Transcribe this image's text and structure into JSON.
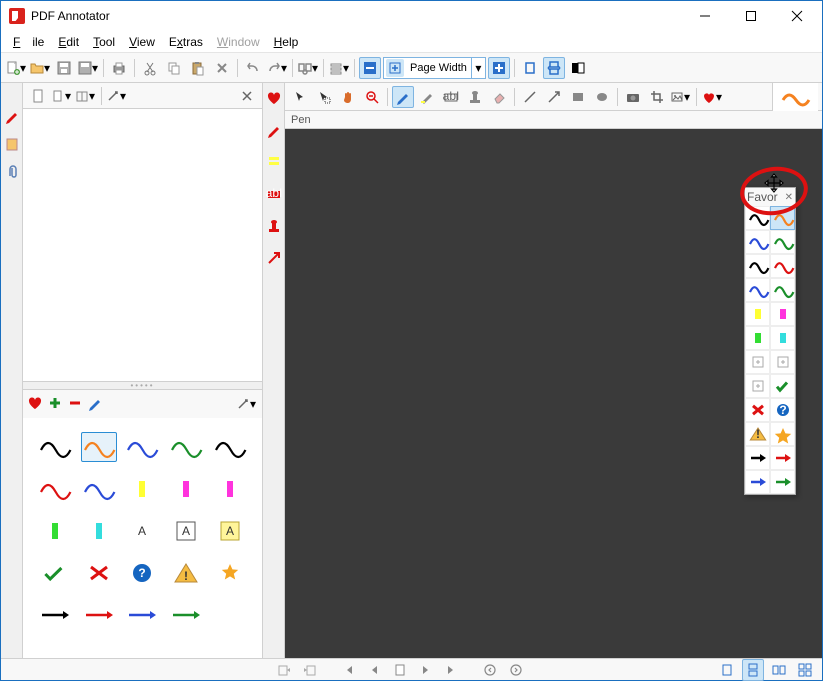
{
  "title": "PDF Annotator",
  "menu": {
    "file": "File",
    "edit": "Edit",
    "tool": "Tool",
    "view": "View",
    "extras": "Extras",
    "window": "Window",
    "help": "Help"
  },
  "zoom": {
    "label": "Page Width"
  },
  "tool_label": "Pen",
  "float_panel": {
    "title": "Favor"
  },
  "favorites_grid": [
    {
      "type": "wave",
      "color": "#000"
    },
    {
      "type": "wave",
      "color": "#f58220"
    },
    {
      "type": "wave",
      "color": "#2a4bd7"
    },
    {
      "type": "wave",
      "color": "#1a8f2a"
    },
    {
      "type": "wave",
      "color": "#000"
    },
    {
      "type": "wave",
      "color": "#d11"
    },
    {
      "type": "wave",
      "color": "#2a4bd7"
    },
    {
      "type": "hl",
      "color": "#ffff33"
    },
    {
      "type": "hl",
      "color": "#ff33dd"
    },
    {
      "type": "hl",
      "color": "#ff33dd"
    },
    {
      "type": "hl",
      "color": "#33dd33"
    },
    {
      "type": "hl",
      "color": "#33dddd"
    },
    {
      "type": "textA",
      "bg": "#fff",
      "border": "#fff"
    },
    {
      "type": "textA",
      "bg": "#fff",
      "border": "#555"
    },
    {
      "type": "textA",
      "bg": "#fff59a",
      "border": "#b8a534"
    },
    {
      "type": "check",
      "color": "#1a8f2a"
    },
    {
      "type": "x",
      "color": "#d11"
    },
    {
      "type": "qmark"
    },
    {
      "type": "warn"
    },
    {
      "type": "star"
    },
    {
      "type": "arrow",
      "color": "#000"
    },
    {
      "type": "arrow",
      "color": "#d11"
    },
    {
      "type": "arrow",
      "color": "#2a4bd7"
    },
    {
      "type": "arrow",
      "color": "#1a8f2a"
    },
    {
      "type": "blank"
    }
  ],
  "float_items": [
    {
      "type": "wave",
      "color": "#000"
    },
    {
      "type": "wave",
      "color": "#f58220",
      "sel": true
    },
    {
      "type": "wave",
      "color": "#2a4bd7"
    },
    {
      "type": "wave",
      "color": "#1a8f2a"
    },
    {
      "type": "wave",
      "color": "#000"
    },
    {
      "type": "wave",
      "color": "#d11"
    },
    {
      "type": "wave",
      "color": "#2a4bd7"
    },
    {
      "type": "wave",
      "color": "#1a8f2a"
    },
    {
      "type": "hl",
      "color": "#ffff33"
    },
    {
      "type": "hl",
      "color": "#ff33dd"
    },
    {
      "type": "hl",
      "color": "#33dd33"
    },
    {
      "type": "hl",
      "color": "#33dddd"
    },
    {
      "type": "sqdoc"
    },
    {
      "type": "sqdoc"
    },
    {
      "type": "sqdoc"
    },
    {
      "type": "check",
      "color": "#1a8f2a"
    },
    {
      "type": "x",
      "color": "#d11"
    },
    {
      "type": "qmark"
    },
    {
      "type": "warn"
    },
    {
      "type": "star"
    },
    {
      "type": "arrow",
      "color": "#000"
    },
    {
      "type": "arrow",
      "color": "#d11"
    },
    {
      "type": "arrow",
      "color": "#2a4bd7"
    },
    {
      "type": "arrow",
      "color": "#1a8f2a"
    }
  ]
}
